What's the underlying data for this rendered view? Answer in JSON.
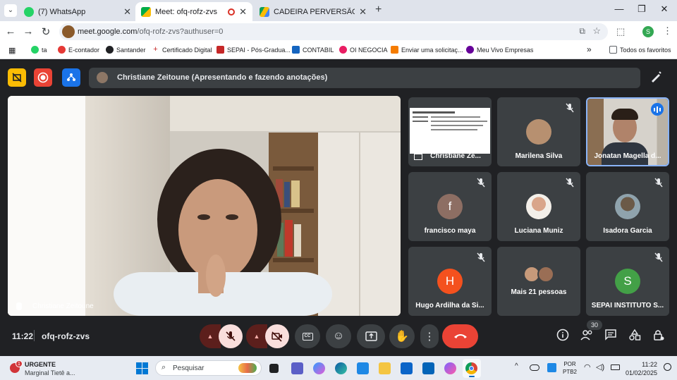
{
  "browser": {
    "tabs": [
      {
        "title": "(7) WhatsApp",
        "active": false
      },
      {
        "title": "Meet: ofq-rofz-zvs",
        "active": true
      },
      {
        "title": "CADEIRA PERVERSÃO: FUNDAM",
        "active": false
      }
    ],
    "new_tab_label": "+",
    "address": {
      "host": "meet.google.com",
      "path": "/ofq-rofz-zvs?authuser=0"
    },
    "profile_initial": "S",
    "bookmarks": [
      "ta",
      "E-contador",
      "Santander",
      "Certificado Digital",
      "SEPAI - Pós-Gradua...",
      "CONTABIL",
      "OI NEGOCIA",
      "Enviar uma solicitaç...",
      "Meu Vivo Empresas"
    ],
    "bookmarks_more": "»",
    "all_favorites": "Todos os favoritos"
  },
  "meet": {
    "presenting_text": "Christiane Zeitoune (Apresentando e fazendo anotações)",
    "main_speaker_name": "Christiane Zeitoune",
    "tiles": [
      {
        "name": "Christiane Ze...",
        "kind": "screen"
      },
      {
        "name": "Marilena Silva",
        "kind": "photo",
        "muted": true
      },
      {
        "name": "Jonatan Magella d...",
        "kind": "video",
        "speaking": true
      },
      {
        "name": "francisco maya",
        "kind": "letter",
        "letter": "f",
        "color": "#8d6e63",
        "muted": true
      },
      {
        "name": "Luciana Muniz",
        "kind": "photo",
        "muted": true
      },
      {
        "name": "Isadora Garcia",
        "kind": "photo",
        "muted": true
      },
      {
        "name": "Hugo Ardilha da Si...",
        "kind": "letter",
        "letter": "H",
        "color": "#f4511e",
        "muted": true
      },
      {
        "name": "Mais 21 pessoas",
        "kind": "more"
      },
      {
        "name": "SEPAI INSTITUTO S...",
        "kind": "letter",
        "letter": "S",
        "color": "#43a047",
        "muted": true
      }
    ],
    "time": "11:22",
    "meeting_code": "ofq-rofz-zvs",
    "people_count": "30"
  },
  "taskbar": {
    "notification_badge": "1",
    "notification_title": "URGENTE",
    "notification_sub": "Marginal Tietê a...",
    "search_placeholder": "Pesquisar",
    "lang_top": "POR",
    "lang_bottom": "PTB2",
    "clock_time": "11:22",
    "clock_date": "01/02/2025"
  }
}
